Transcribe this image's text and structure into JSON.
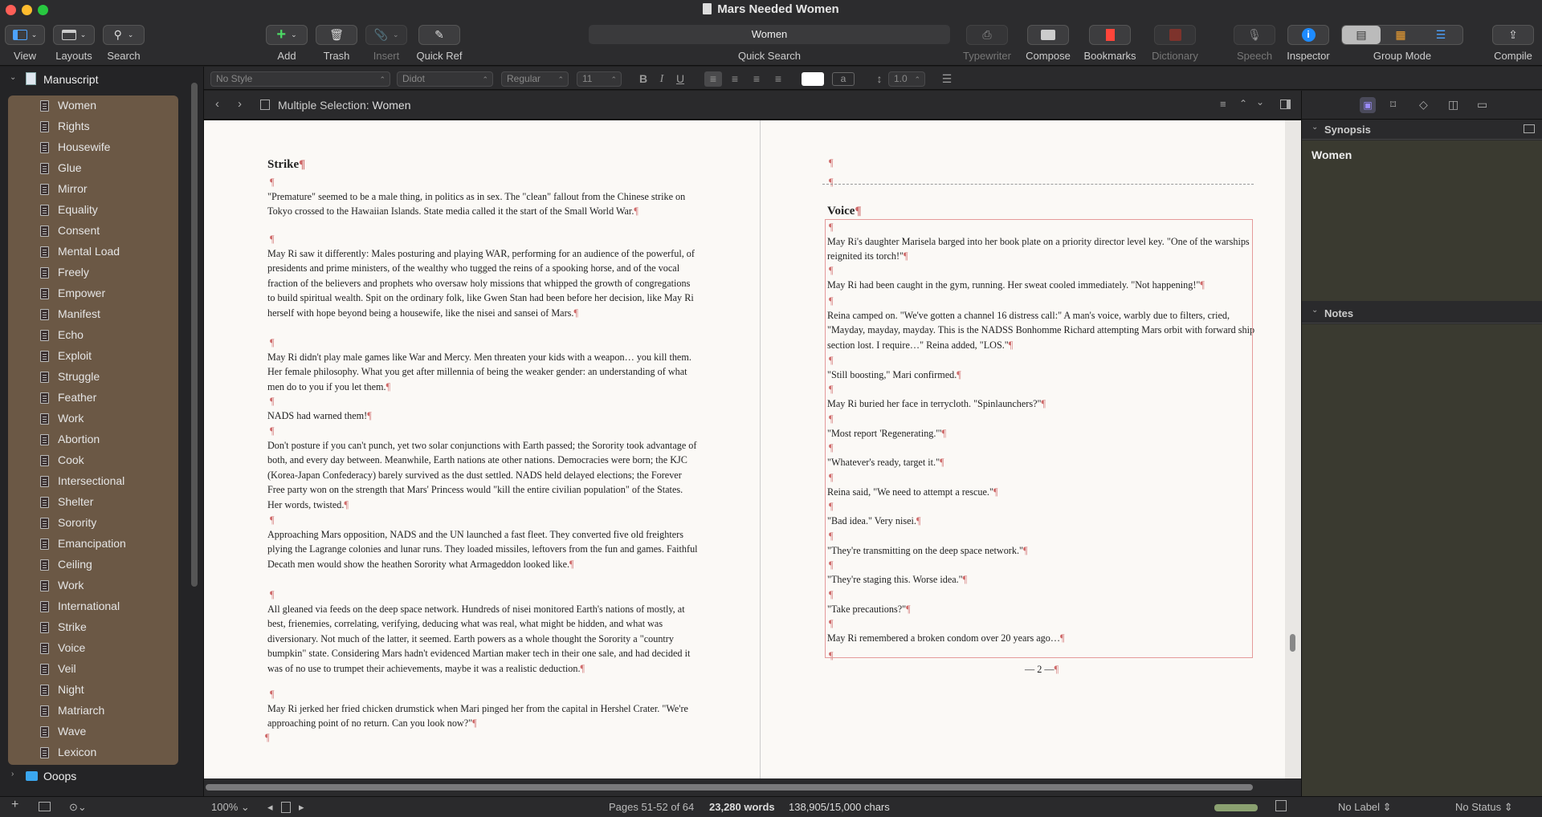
{
  "window": {
    "title": "Mars Needed Women"
  },
  "toolbar": {
    "view": "View",
    "layouts": "Layouts",
    "search": "Search",
    "add": "Add",
    "trash": "Trash",
    "insert": "Insert",
    "quick_ref": "Quick Ref",
    "quick_search_value": "Women",
    "quick_search": "Quick Search",
    "typewriter": "Typewriter",
    "compose": "Compose",
    "bookmarks": "Bookmarks",
    "dictionary": "Dictionary",
    "speech": "Speech",
    "inspector": "Inspector",
    "group_mode": "Group Mode",
    "compile": "Compile"
  },
  "format": {
    "style": "No Style",
    "font": "Didot",
    "weight": "Regular",
    "size": "11",
    "bold": "B",
    "italic": "I",
    "underline": "U",
    "spacing": "1.0"
  },
  "binder": {
    "root": "Manuscript",
    "items": [
      "Women",
      "Rights",
      "Housewife",
      "Glue",
      "Mirror",
      "Equality",
      "Consent",
      "Mental Load",
      "Freely",
      "Empower",
      "Manifest",
      "Echo",
      "Exploit",
      "Struggle",
      "Feather",
      "Work",
      "Abortion",
      "Cook",
      "Intersectional",
      "Shelter",
      "Sorority",
      "Emancipation",
      "Ceiling",
      "Work",
      "International",
      "Strike",
      "Voice",
      "Veil",
      "Night",
      "Matriarch",
      "Wave",
      "Lexicon"
    ],
    "folder": "Ooops"
  },
  "editor": {
    "header_prefix": "Multiple Selection:",
    "header_title": "Women",
    "pilcrow": "¶",
    "left": {
      "heading": "Strike",
      "paras": [
        "\"Premature\" seemed to be a male thing, in politics as in sex. The \"clean\" fallout from the Chinese strike on Tokyo crossed to the Hawaiian Islands. State media called it the start of the Small World War.",
        "May Ri saw it differently: Males posturing and playing WAR, performing for an audience of the powerful, of presidents and prime ministers, of the wealthy who tugged the reins of a spooking horse, and of the vocal fraction of the believers and prophets who oversaw holy missions that whipped the growth of congregations to build spiritual wealth. Spit on the ordinary folk, like Gwen Stan had been before her decision, like May Ri herself with hope beyond being a housewife, like the nisei and sansei of Mars.",
        "May Ri didn't play male games like War and Mercy. Men threaten your kids with a weapon… you kill them. Her female philosophy. What you get after millennia of being the weaker gender: an understanding of what men do to you if you let them.",
        "NADS had warned them!",
        "Don't posture if you can't punch, yet two solar conjunctions with Earth passed; the Sorority took advantage of both, and every day between. Meanwhile, Earth nations ate other nations. Democracies were born; the KJC (Korea-Japan Confederacy) barely survived as the dust settled. NADS held delayed elections; the Forever Free party won on the strength that Mars' Princess would \"kill the entire civilian population\" of the States. Her words, twisted.",
        "Approaching Mars opposition, NADS and the UN launched a fast fleet. They converted five old freighters plying the Lagrange colonies and lunar runs. They loaded missiles, leftovers from the fun and games. Faithful Decath men would show the heathen Sorority what Armageddon looked like.",
        "All gleaned via feeds on the deep space network. Hundreds of nisei monitored Earth's nations of mostly, at best, frienemies, correlating, verifying, deducing what was real, what might be hidden, and what was diversionary. Not much of the latter, it seemed. Earth powers as a whole thought the Sorority a \"country bumpkin\" state. Considering Mars hadn't evidenced Martian maker tech in their one sale, and had decided it was of no use to trumpet their achievements, maybe it was a realistic deduction.",
        "May Ri jerked her fried chicken drumstick when Mari pinged her from the capital in Hershel Crater. \"We're approaching point of no return. Can you look now?\""
      ]
    },
    "right": {
      "heading": "Voice",
      "paras": [
        "May Ri's daughter Marisela barged into her book plate on a priority director level key. \"One of the warships reignited its torch!\"",
        "May Ri had been caught in the gym, running. Her sweat cooled immediately. \"Not happening!\"",
        "Reina camped on. \"We've gotten a channel 16 distress call:\" A man's voice, warbly due to filters, cried, \"Mayday, mayday, mayday. This is the NADSS Bonhomme Richard attempting Mars orbit with forward ship section lost. I require…\" Reina added, \"LOS.\"",
        "\"Still boosting,\" Mari confirmed.",
        "May Ri buried her face in terrycloth. \"Spinlaunchers?\"",
        "\"Most report 'Regenerating.'\"",
        "\"Whatever's ready, target it.\"",
        "Reina said, \"We need to attempt a rescue.\"",
        "\"Bad idea.\" Very nisei.",
        "\"They're transmitting on the deep space network.\"",
        "\"They're staging this. Worse idea.\"",
        "\"Take precautions?\"",
        "May Ri remembered a broken condom over 20 years ago…"
      ],
      "page_footer": "— 2 —"
    }
  },
  "inspector": {
    "synopsis_label": "Synopsis",
    "synopsis_title": "Women",
    "notes_label": "Notes"
  },
  "status": {
    "zoom": "100%",
    "pages": "Pages 51-52 of 64",
    "words": "23,280 words",
    "chars": "138,905/15,000 chars",
    "label": "No Label",
    "status": "No Status"
  },
  "colors": {
    "accent": "#6b5845",
    "pilcrow": "#cf6b6b",
    "page": "#fbf9f6"
  }
}
